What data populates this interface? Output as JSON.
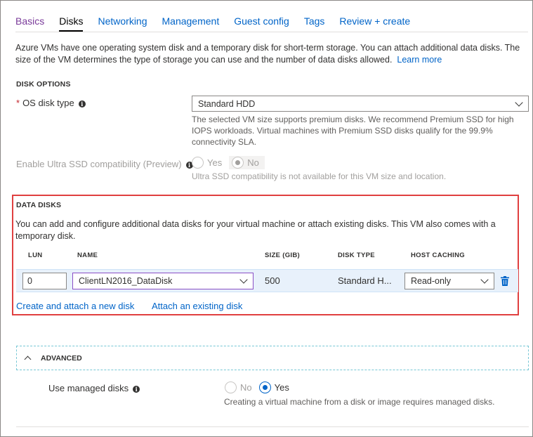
{
  "tabs": [
    {
      "label": "Basics"
    },
    {
      "label": "Disks"
    },
    {
      "label": "Networking"
    },
    {
      "label": "Management"
    },
    {
      "label": "Guest config"
    },
    {
      "label": "Tags"
    },
    {
      "label": "Review + create"
    }
  ],
  "active_tab": "Disks",
  "intro": {
    "text": "Azure VMs have one operating system disk and a temporary disk for short-term storage. You can attach additional data disks. The size of the VM determines the type of storage you can use and the number of data disks allowed.",
    "link": "Learn more"
  },
  "disk_options": {
    "heading": "DISK OPTIONS",
    "os_disk_type": {
      "required_mark": "*",
      "label": "OS disk type",
      "value": "Standard HDD",
      "help": "The selected VM size supports premium disks. We recommend Premium SSD for high IOPS workloads. Virtual machines with Premium SSD disks qualify for the 99.9% connectivity SLA."
    },
    "ultra_ssd": {
      "label": "Enable Ultra SSD compatibility (Preview)",
      "options": [
        "Yes",
        "No"
      ],
      "selected": "No",
      "help": "Ultra SSD compatibility is not available for this VM size and location."
    }
  },
  "data_disks": {
    "heading": "DATA DISKS",
    "description": "You can add and configure additional data disks for your virtual machine or attach existing disks. This VM also comes with a temporary disk.",
    "columns": [
      "LUN",
      "NAME",
      "SIZE (GIB)",
      "DISK TYPE",
      "HOST CACHING"
    ],
    "rows": [
      {
        "lun": "0",
        "name": "ClientLN2016_DataDisk",
        "size": "500",
        "disk_type": "Standard H...",
        "host_caching": "Read-only"
      }
    ],
    "create_link": "Create and attach a new disk",
    "attach_link": "Attach an existing disk"
  },
  "advanced": {
    "heading": "ADVANCED",
    "managed_disks": {
      "label": "Use managed disks",
      "options": [
        "No",
        "Yes"
      ],
      "selected": "Yes",
      "help": "Creating a virtual machine from a disk or image requires managed disks."
    }
  },
  "colors": {
    "link": "#0064c8",
    "highlight": "#e04040",
    "required": "#c4262e",
    "row_bg": "#e8f1fb"
  }
}
